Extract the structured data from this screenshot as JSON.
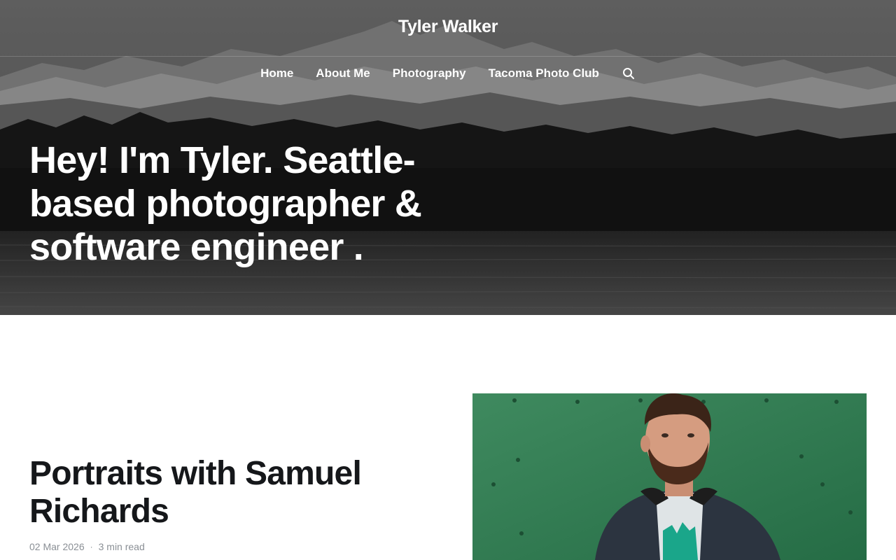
{
  "site": {
    "title": "Tyler Walker"
  },
  "nav": {
    "items": [
      {
        "label": "Home"
      },
      {
        "label": "About Me"
      },
      {
        "label": "Photography"
      },
      {
        "label": "Tacoma Photo Club"
      }
    ],
    "search_icon": "search-icon"
  },
  "hero": {
    "heading": "Hey! I'm Tyler. Seattle-based photographer & software engineer ."
  },
  "post": {
    "title": "Portraits with Samuel Richards",
    "date": "02 Mar 2026",
    "separator": "·",
    "reading_time": "3 min read"
  },
  "colors": {
    "text_dark": "#15171a",
    "meta_gray": "#8a8f95",
    "portrait_green": "#2f7d52"
  }
}
